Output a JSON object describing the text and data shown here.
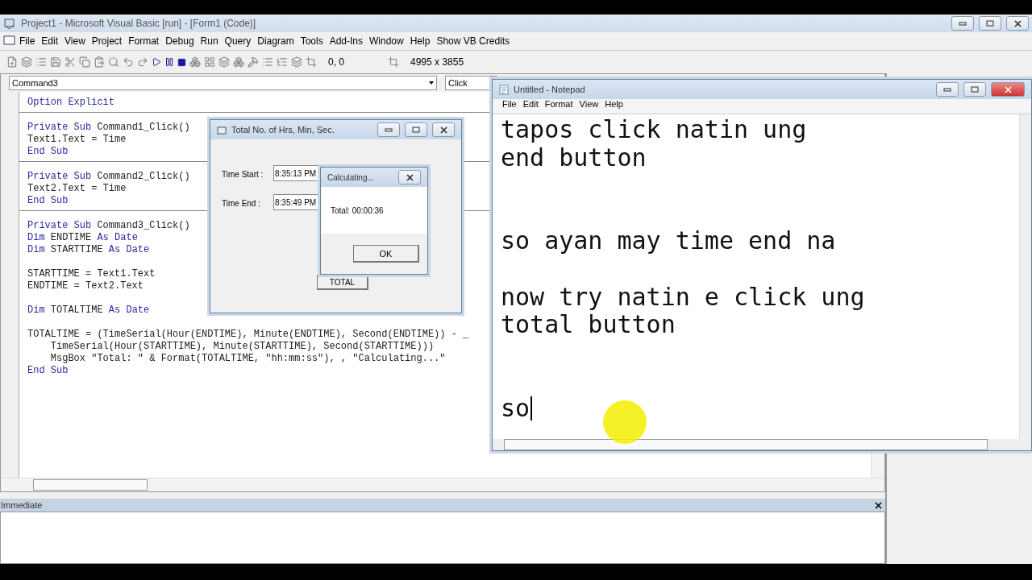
{
  "vb_window": {
    "title": "Project1 - Microsoft Visual Basic [run] - [Form1 (Code)]",
    "menu": [
      "File",
      "Edit",
      "View",
      "Project",
      "Format",
      "Debug",
      "Run",
      "Query",
      "Diagram",
      "Tools",
      "Add-Ins",
      "Window",
      "Help",
      "Show VB Credits"
    ],
    "toolbar": {
      "position": "0, 0",
      "size": "4995 x 3855"
    },
    "code_window": {
      "object": "Command3",
      "procedure": "Click",
      "blocks": [
        [
          [
            [
              {
                "t": "Option Explicit",
                "kind": "keyword"
              }
            ]
          ]
        ],
        [
          [
            [
              {
                "t": "Private Sub",
                "kind": "keyword"
              },
              {
                "t": " Command1_Click()",
                "kind": "plain"
              }
            ],
            [
              {
                "t": "Text1.Text = Time",
                "kind": "plain"
              }
            ],
            [
              {
                "t": "End Sub",
                "kind": "keyword"
              }
            ]
          ]
        ],
        [
          [
            [
              {
                "t": "Private Sub",
                "kind": "keyword"
              },
              {
                "t": " Command2_Click()",
                "kind": "plain"
              }
            ],
            [
              {
                "t": "Text2.Text = Time",
                "kind": "plain"
              }
            ],
            [
              {
                "t": "End Sub",
                "kind": "keyword"
              }
            ]
          ]
        ],
        [
          [
            [
              {
                "t": "Private Sub",
                "kind": "keyword"
              },
              {
                "t": " Command3_Click()",
                "kind": "plain"
              }
            ],
            [
              {
                "t": "Dim",
                "kind": "keyword"
              },
              {
                "t": " ENDTIME ",
                "kind": "plain"
              },
              {
                "t": "As Date",
                "kind": "keyword"
              }
            ],
            [
              {
                "t": "Dim",
                "kind": "keyword"
              },
              {
                "t": " STARTTIME ",
                "kind": "plain"
              },
              {
                "t": "As Date",
                "kind": "keyword"
              }
            ]
          ],
          [
            [
              {
                "t": "STARTTIME = Text1.Text",
                "kind": "plain"
              }
            ],
            [
              {
                "t": "ENDTIME = Text2.Text",
                "kind": "plain"
              }
            ]
          ],
          [
            [
              {
                "t": "Dim",
                "kind": "keyword"
              },
              {
                "t": " TOTALTIME ",
                "kind": "plain"
              },
              {
                "t": "As Date",
                "kind": "keyword"
              }
            ]
          ],
          [
            [
              {
                "t": "TOTALTIME = (TimeSerial(Hour(ENDTIME), Minute(ENDTIME), Second(ENDTIME)) - _",
                "kind": "plain"
              }
            ],
            [
              {
                "t": "    TimeSerial(Hour(STARTTIME), Minute(STARTTIME), Second(STARTTIME)))",
                "kind": "plain"
              }
            ],
            [
              {
                "t": "    MsgBox \"Total: \" & Format(TOTALTIME, \"hh:mm:ss\"), , \"Calculating...\"",
                "kind": "plain"
              }
            ],
            [
              {
                "t": "End Sub",
                "kind": "keyword"
              }
            ]
          ]
        ]
      ]
    },
    "immediate": {
      "title": "Immediate"
    }
  },
  "form_window": {
    "title": "Total No. of Hrs, Min, Sec.",
    "fields": [
      {
        "label": "Time Start :",
        "value": "8:35:13 PM"
      },
      {
        "label": "Time End :",
        "value": "8:35:49 PM"
      }
    ],
    "button": "TOTAL"
  },
  "message_box": {
    "title": "Calculating...",
    "message": "Total: 00:00:36",
    "button": "OK"
  },
  "notepad": {
    "title": "Untitled - Notepad",
    "menu": [
      "File",
      "Edit",
      "Format",
      "View",
      "Help"
    ],
    "caret": true,
    "sections": [
      [
        [
          "tapos click natin ung",
          "end button"
        ]
      ],
      [
        [
          "so ayan may time end na"
        ],
        [
          "now try natin e click ung",
          "total button"
        ]
      ],
      [
        [
          "so"
        ]
      ]
    ]
  }
}
